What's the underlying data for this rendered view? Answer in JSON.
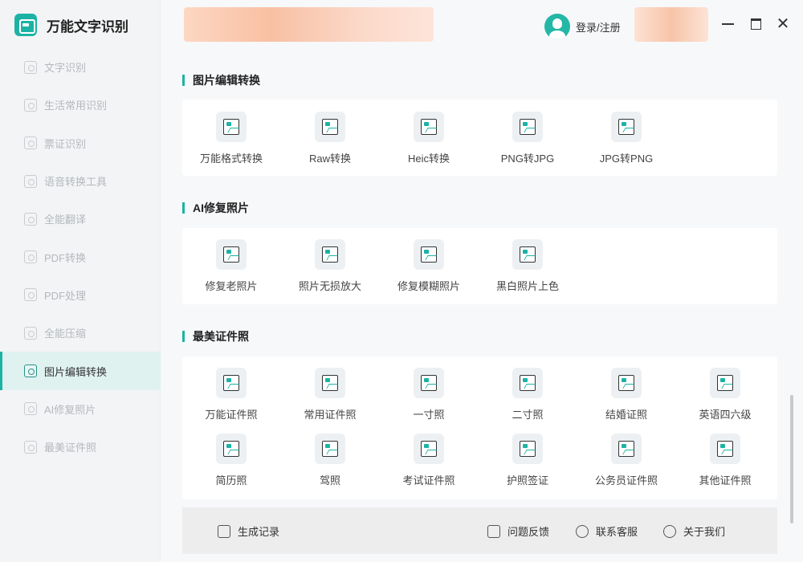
{
  "app": {
    "title": "万能文字识别"
  },
  "sidebar": {
    "items": [
      {
        "label": "文字识别",
        "icon": "scan-text-icon",
        "active": false
      },
      {
        "label": "生活常用识别",
        "icon": "scan-life-icon",
        "active": false
      },
      {
        "label": "票证识别",
        "icon": "scan-ticket-icon",
        "active": false
      },
      {
        "label": "语音转换工具",
        "icon": "voice-convert-icon",
        "active": false
      },
      {
        "label": "全能翻译",
        "icon": "translate-icon",
        "active": false
      },
      {
        "label": "PDF转换",
        "icon": "pdf-convert-icon",
        "active": false
      },
      {
        "label": "PDF处理",
        "icon": "pdf-process-icon",
        "active": false
      },
      {
        "label": "全能压缩",
        "icon": "compress-icon",
        "active": false
      },
      {
        "label": "图片编辑转换",
        "icon": "image-edit-icon",
        "active": true
      },
      {
        "label": "AI修复照片",
        "icon": "ai-repair-icon",
        "active": false
      },
      {
        "label": "最美证件照",
        "icon": "id-photo-icon",
        "active": false
      }
    ]
  },
  "header": {
    "login_label": "登录/注册"
  },
  "sections": [
    {
      "title": "图片编辑转换",
      "tools": [
        "万能格式转换",
        "Raw转换",
        "Heic转换",
        "PNG转JPG",
        "JPG转PNG"
      ]
    },
    {
      "title": "AI修复照片",
      "tools": [
        "修复老照片",
        "照片无损放大",
        "修复模糊照片",
        "黑白照片上色"
      ]
    },
    {
      "title": "最美证件照",
      "tools": [
        "万能证件照",
        "常用证件照",
        "一寸照",
        "二寸照",
        "结婚证照",
        "英语四六级",
        "简历照",
        "驾照",
        "考试证件照",
        "护照签证",
        "公务员证件照",
        "其他证件照"
      ]
    }
  ],
  "footer": {
    "history": "生成记录",
    "feedback": "问题反馈",
    "service": "联系客服",
    "about": "关于我们"
  },
  "colors": {
    "accent": "#1cb3a4",
    "active_bg": "#dff2f0"
  }
}
